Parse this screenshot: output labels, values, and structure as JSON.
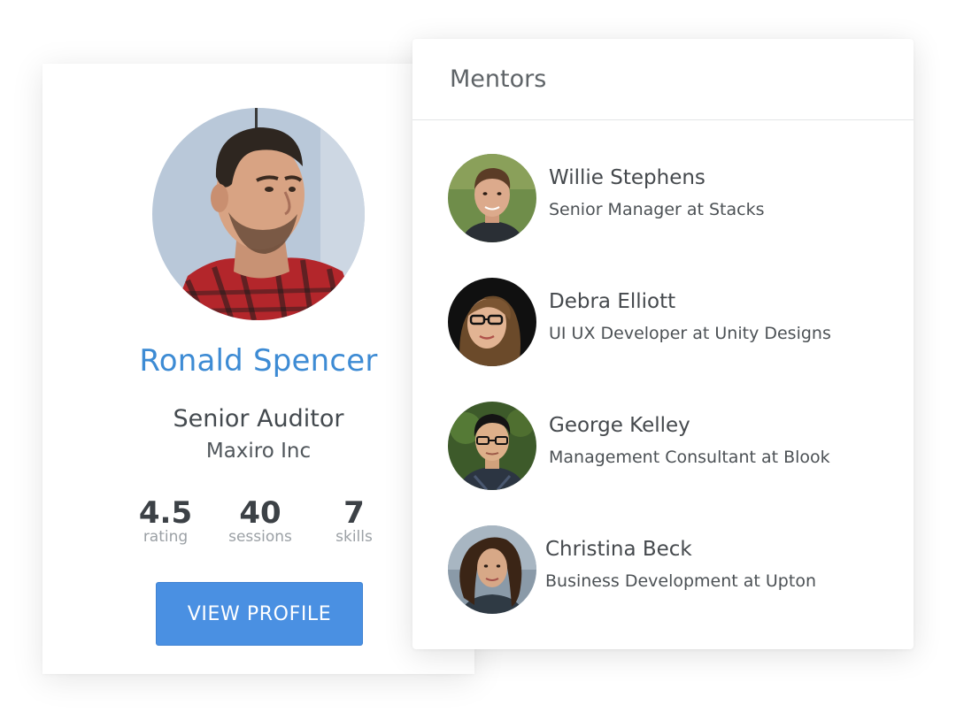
{
  "profile": {
    "name": "Ronald Spencer",
    "role": "Senior Auditor",
    "company": "Maxiro Inc",
    "stats": [
      {
        "value": "4.5",
        "label": "rating"
      },
      {
        "value": "40",
        "label": "sessions"
      },
      {
        "value": "7",
        "label": "skills"
      }
    ],
    "button_label": "VIEW PROFILE"
  },
  "mentors": {
    "title": "Mentors",
    "items": [
      {
        "name": "Willie Stephens",
        "title": "Senior Manager at Stacks"
      },
      {
        "name": "Debra Elliott",
        "title": "UI UX Developer at Unity Designs"
      },
      {
        "name": "George Kelley",
        "title": "Management Consultant at Blook"
      },
      {
        "name": "Christina Beck",
        "title": "Business Development at Upton"
      }
    ]
  },
  "colors": {
    "accent": "#3d8bd4",
    "button": "#4a90e2",
    "text": "#444a4f",
    "muted": "#9ba0a5"
  }
}
